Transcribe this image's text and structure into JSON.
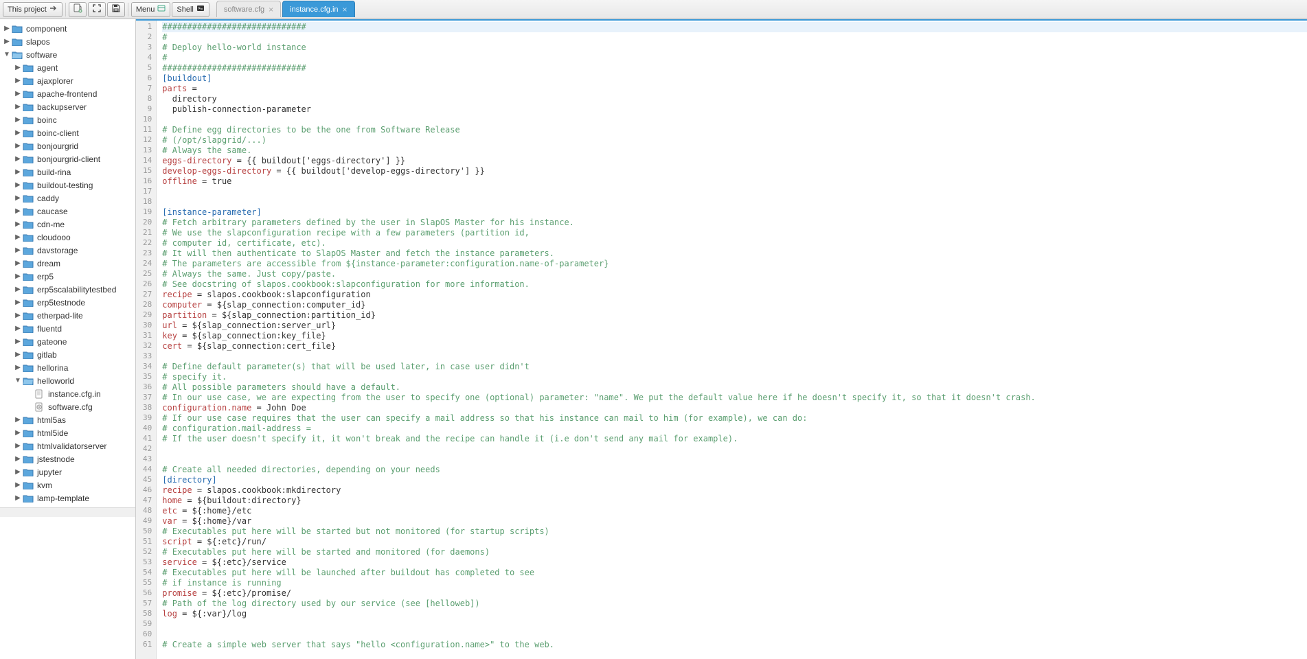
{
  "toolbar": {
    "project_dropdown": "This project",
    "menu_label": "Menu",
    "shell_label": "Shell"
  },
  "tabs": [
    {
      "label": "software.cfg",
      "active": false
    },
    {
      "label": "instance.cfg.in",
      "active": true
    }
  ],
  "tree": {
    "roots": [
      {
        "name": "component",
        "expanded": false,
        "kind": "folder"
      },
      {
        "name": "slapos",
        "expanded": false,
        "kind": "folder"
      },
      {
        "name": "software",
        "expanded": true,
        "kind": "folder-open",
        "children": [
          {
            "name": "agent",
            "kind": "folder"
          },
          {
            "name": "ajaxplorer",
            "kind": "folder"
          },
          {
            "name": "apache-frontend",
            "kind": "folder"
          },
          {
            "name": "backupserver",
            "kind": "folder"
          },
          {
            "name": "boinc",
            "kind": "folder"
          },
          {
            "name": "boinc-client",
            "kind": "folder"
          },
          {
            "name": "bonjourgrid",
            "kind": "folder"
          },
          {
            "name": "bonjourgrid-client",
            "kind": "folder"
          },
          {
            "name": "build-rina",
            "kind": "folder"
          },
          {
            "name": "buildout-testing",
            "kind": "folder"
          },
          {
            "name": "caddy",
            "kind": "folder"
          },
          {
            "name": "caucase",
            "kind": "folder"
          },
          {
            "name": "cdn-me",
            "kind": "folder"
          },
          {
            "name": "cloudooo",
            "kind": "folder"
          },
          {
            "name": "davstorage",
            "kind": "folder"
          },
          {
            "name": "dream",
            "kind": "folder"
          },
          {
            "name": "erp5",
            "kind": "folder"
          },
          {
            "name": "erp5scalabilitytestbed",
            "kind": "folder"
          },
          {
            "name": "erp5testnode",
            "kind": "folder"
          },
          {
            "name": "etherpad-lite",
            "kind": "folder"
          },
          {
            "name": "fluentd",
            "kind": "folder"
          },
          {
            "name": "gateone",
            "kind": "folder"
          },
          {
            "name": "gitlab",
            "kind": "folder"
          },
          {
            "name": "hellorina",
            "kind": "folder"
          },
          {
            "name": "helloworld",
            "expanded": true,
            "kind": "folder-open",
            "children": [
              {
                "name": "instance.cfg.in",
                "kind": "file"
              },
              {
                "name": "software.cfg",
                "kind": "file-cfg"
              }
            ]
          },
          {
            "name": "html5as",
            "kind": "folder"
          },
          {
            "name": "html5ide",
            "kind": "folder"
          },
          {
            "name": "htmlvalidatorserver",
            "kind": "folder"
          },
          {
            "name": "jstestnode",
            "kind": "folder"
          },
          {
            "name": "jupyter",
            "kind": "folder"
          },
          {
            "name": "kvm",
            "kind": "folder"
          },
          {
            "name": "lamp-template",
            "kind": "folder"
          }
        ]
      }
    ]
  },
  "editor": {
    "filename": "instance.cfg.in",
    "lines": [
      {
        "n": 1,
        "t": "#############################",
        "cls": "c-comment",
        "hl": true
      },
      {
        "n": 2,
        "t": "#",
        "cls": "c-comment"
      },
      {
        "n": 3,
        "t": "# Deploy hello-world instance",
        "cls": "c-comment"
      },
      {
        "n": 4,
        "t": "#",
        "cls": "c-comment"
      },
      {
        "n": 5,
        "t": "#############################",
        "cls": "c-comment"
      },
      {
        "n": 6,
        "t": "[buildout]",
        "cls": "c-section"
      },
      {
        "n": 7,
        "segs": [
          {
            "t": "parts ",
            "cls": "c-key"
          },
          {
            "t": "=",
            "cls": "c-val"
          }
        ]
      },
      {
        "n": 8,
        "t": "  directory",
        "cls": "c-val"
      },
      {
        "n": 9,
        "t": "  publish-connection-parameter",
        "cls": "c-val"
      },
      {
        "n": 10,
        "t": "",
        "cls": ""
      },
      {
        "n": 11,
        "t": "# Define egg directories to be the one from Software Release",
        "cls": "c-comment"
      },
      {
        "n": 12,
        "t": "# (/opt/slapgrid/...)",
        "cls": "c-comment"
      },
      {
        "n": 13,
        "t": "# Always the same.",
        "cls": "c-comment"
      },
      {
        "n": 14,
        "segs": [
          {
            "t": "eggs-directory ",
            "cls": "c-key"
          },
          {
            "t": "= {{ buildout['eggs-directory'] }}",
            "cls": "c-val"
          }
        ]
      },
      {
        "n": 15,
        "segs": [
          {
            "t": "develop-eggs-directory ",
            "cls": "c-key"
          },
          {
            "t": "= {{ buildout['develop-eggs-directory'] }}",
            "cls": "c-val"
          }
        ]
      },
      {
        "n": 16,
        "segs": [
          {
            "t": "offline ",
            "cls": "c-key"
          },
          {
            "t": "= true",
            "cls": "c-val"
          }
        ]
      },
      {
        "n": 17,
        "t": "",
        "cls": ""
      },
      {
        "n": 18,
        "t": "",
        "cls": ""
      },
      {
        "n": 19,
        "t": "[instance-parameter]",
        "cls": "c-section"
      },
      {
        "n": 20,
        "t": "# Fetch arbitrary parameters defined by the user in SlapOS Master for his instance.",
        "cls": "c-comment"
      },
      {
        "n": 21,
        "t": "# We use the slapconfiguration recipe with a few parameters (partition id,",
        "cls": "c-comment"
      },
      {
        "n": 22,
        "t": "# computer id, certificate, etc).",
        "cls": "c-comment"
      },
      {
        "n": 23,
        "t": "# It will then authenticate to SlapOS Master and fetch the instance parameters.",
        "cls": "c-comment"
      },
      {
        "n": 24,
        "t": "# The parameters are accessible from ${instance-parameter:configuration.name-of-parameter}",
        "cls": "c-comment"
      },
      {
        "n": 25,
        "t": "# Always the same. Just copy/paste.",
        "cls": "c-comment"
      },
      {
        "n": 26,
        "t": "# See docstring of slapos.cookbook:slapconfiguration for more information.",
        "cls": "c-comment"
      },
      {
        "n": 27,
        "segs": [
          {
            "t": "recipe ",
            "cls": "c-key"
          },
          {
            "t": "= slapos.cookbook:slapconfiguration",
            "cls": "c-val"
          }
        ]
      },
      {
        "n": 28,
        "segs": [
          {
            "t": "computer ",
            "cls": "c-key"
          },
          {
            "t": "= ${slap_connection:computer_id}",
            "cls": "c-val"
          }
        ]
      },
      {
        "n": 29,
        "segs": [
          {
            "t": "partition ",
            "cls": "c-key"
          },
          {
            "t": "= ${slap_connection:partition_id}",
            "cls": "c-val"
          }
        ]
      },
      {
        "n": 30,
        "segs": [
          {
            "t": "url ",
            "cls": "c-key"
          },
          {
            "t": "= ${slap_connection:server_url}",
            "cls": "c-val"
          }
        ]
      },
      {
        "n": 31,
        "segs": [
          {
            "t": "key ",
            "cls": "c-key"
          },
          {
            "t": "= ${slap_connection:key_file}",
            "cls": "c-val"
          }
        ]
      },
      {
        "n": 32,
        "segs": [
          {
            "t": "cert ",
            "cls": "c-key"
          },
          {
            "t": "= ${slap_connection:cert_file}",
            "cls": "c-val"
          }
        ]
      },
      {
        "n": 33,
        "t": "",
        "cls": ""
      },
      {
        "n": 34,
        "t": "# Define default parameter(s) that will be used later, in case user didn't",
        "cls": "c-comment"
      },
      {
        "n": 35,
        "t": "# specify it.",
        "cls": "c-comment"
      },
      {
        "n": 36,
        "t": "# All possible parameters should have a default.",
        "cls": "c-comment"
      },
      {
        "n": 37,
        "t": "# In our use case, we are expecting from the user to specify one (optional) parameter: \"name\". We put the default value here if he doesn't specify it, so that it doesn't crash.",
        "cls": "c-comment"
      },
      {
        "n": 38,
        "segs": [
          {
            "t": "configuration.name ",
            "cls": "c-key"
          },
          {
            "t": "= John Doe",
            "cls": "c-val"
          }
        ]
      },
      {
        "n": 39,
        "t": "# If our use case requires that the user can specify a mail address so that his instance can mail to him (for example), we can do:",
        "cls": "c-comment"
      },
      {
        "n": 40,
        "t": "# configuration.mail-address =",
        "cls": "c-comment"
      },
      {
        "n": 41,
        "t": "# If the user doesn't specify it, it won't break and the recipe can handle it (i.e don't send any mail for example).",
        "cls": "c-comment"
      },
      {
        "n": 42,
        "t": "",
        "cls": ""
      },
      {
        "n": 43,
        "t": "",
        "cls": ""
      },
      {
        "n": 44,
        "t": "# Create all needed directories, depending on your needs",
        "cls": "c-comment"
      },
      {
        "n": 45,
        "t": "[directory]",
        "cls": "c-section"
      },
      {
        "n": 46,
        "segs": [
          {
            "t": "recipe ",
            "cls": "c-key"
          },
          {
            "t": "= slapos.cookbook:mkdirectory",
            "cls": "c-val"
          }
        ]
      },
      {
        "n": 47,
        "segs": [
          {
            "t": "home ",
            "cls": "c-key"
          },
          {
            "t": "= ${buildout:directory}",
            "cls": "c-val"
          }
        ]
      },
      {
        "n": 48,
        "segs": [
          {
            "t": "etc ",
            "cls": "c-key"
          },
          {
            "t": "= ${:home}/etc",
            "cls": "c-val"
          }
        ]
      },
      {
        "n": 49,
        "segs": [
          {
            "t": "var ",
            "cls": "c-key"
          },
          {
            "t": "= ${:home}/var",
            "cls": "c-val"
          }
        ]
      },
      {
        "n": 50,
        "t": "# Executables put here will be started but not monitored (for startup scripts)",
        "cls": "c-comment"
      },
      {
        "n": 51,
        "segs": [
          {
            "t": "script ",
            "cls": "c-key"
          },
          {
            "t": "= ${:etc}/run/",
            "cls": "c-val"
          }
        ]
      },
      {
        "n": 52,
        "t": "# Executables put here will be started and monitored (for daemons)",
        "cls": "c-comment"
      },
      {
        "n": 53,
        "segs": [
          {
            "t": "service ",
            "cls": "c-key"
          },
          {
            "t": "= ${:etc}/service",
            "cls": "c-val"
          }
        ]
      },
      {
        "n": 54,
        "t": "# Executables put here will be launched after buildout has completed to see",
        "cls": "c-comment"
      },
      {
        "n": 55,
        "t": "# if instance is running",
        "cls": "c-comment"
      },
      {
        "n": 56,
        "segs": [
          {
            "t": "promise ",
            "cls": "c-key"
          },
          {
            "t": "= ${:etc}/promise/",
            "cls": "c-val"
          }
        ]
      },
      {
        "n": 57,
        "t": "# Path of the log directory used by our service (see [helloweb])",
        "cls": "c-comment"
      },
      {
        "n": 58,
        "segs": [
          {
            "t": "log ",
            "cls": "c-key"
          },
          {
            "t": "= ${:var}/log",
            "cls": "c-val"
          }
        ]
      },
      {
        "n": 59,
        "t": "",
        "cls": ""
      },
      {
        "n": 60,
        "t": "",
        "cls": ""
      },
      {
        "n": 61,
        "t": "# Create a simple web server that says \"hello <configuration.name>\" to the web.",
        "cls": "c-comment"
      }
    ]
  }
}
